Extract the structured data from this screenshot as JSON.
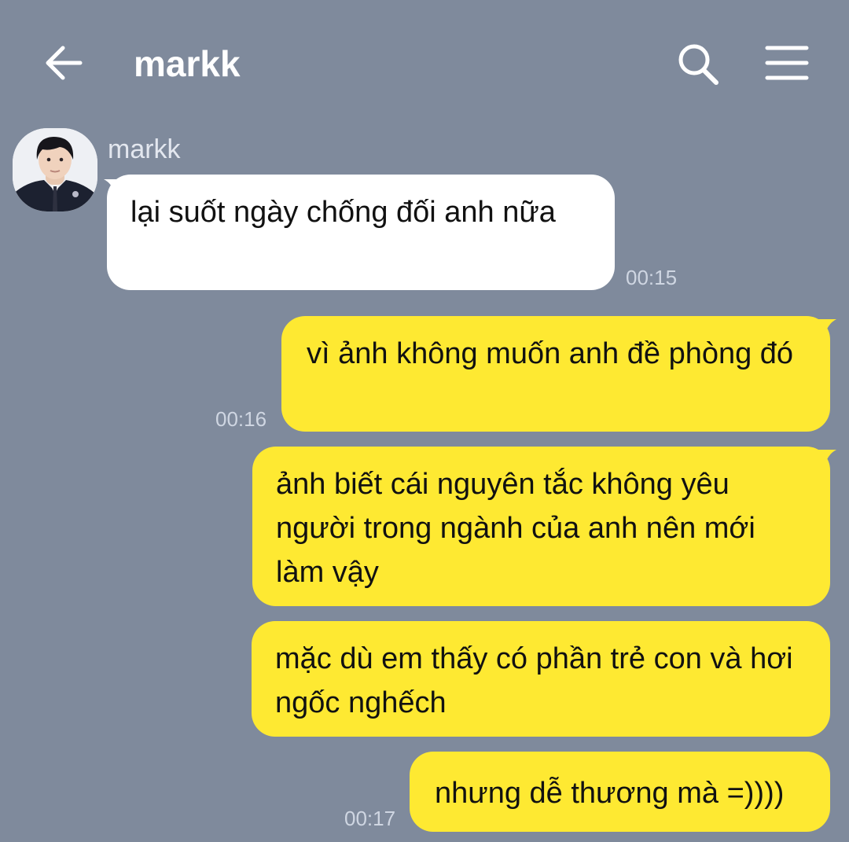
{
  "header": {
    "title": "markk",
    "back_icon": "arrow-left-icon",
    "search_icon": "search-icon",
    "menu_icon": "hamburger-menu-icon"
  },
  "colors": {
    "background": "#7f8a9c",
    "incoming_bubble": "#ffffff",
    "outgoing_bubble": "#fee932"
  },
  "messages": [
    {
      "sender": "markk",
      "direction": "incoming",
      "text": "lại suốt ngày chống đối anh nữa",
      "time": "00:15"
    },
    {
      "direction": "outgoing",
      "text": "vì ảnh không muốn anh đề phòng đó",
      "time": "00:16"
    },
    {
      "direction": "outgoing",
      "text": "ảnh biết cái nguyên tắc không yêu người trong ngành của anh nên mới làm vậy",
      "time": ""
    },
    {
      "direction": "outgoing",
      "text": "mặc dù em thấy có phần trẻ con và hơi ngốc nghếch",
      "time": ""
    },
    {
      "direction": "outgoing",
      "text": "nhưng dễ thương mà =))))",
      "time": "00:17"
    }
  ]
}
